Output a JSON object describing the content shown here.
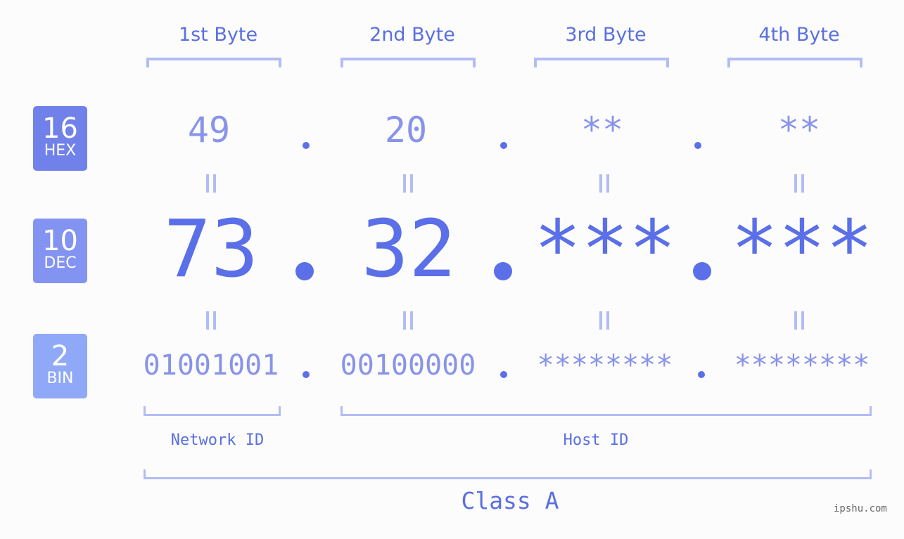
{
  "headers": [
    "1st Byte",
    "2nd Byte",
    "3rd Byte",
    "4th Byte"
  ],
  "badges": [
    {
      "num": "16",
      "label": "HEX",
      "color": "#7181ea"
    },
    {
      "num": "10",
      "label": "DEC",
      "color": "#8393f2"
    },
    {
      "num": "2",
      "label": "BIN",
      "color": "#8fa8f8"
    }
  ],
  "hex": [
    "49",
    "20",
    "**",
    "**"
  ],
  "dec": [
    "73",
    "32",
    "***",
    "***"
  ],
  "bin": [
    "01001001",
    "00100000",
    "********",
    "********"
  ],
  "labels": {
    "network": "Network ID",
    "host": "Host ID",
    "class": "Class A"
  },
  "watermark": "ipshu.com",
  "colors": {
    "accent": "#5a6fe8",
    "light_text": "#8893ea",
    "bracket": "#b3bcf5",
    "background": "#fbfcfb"
  }
}
